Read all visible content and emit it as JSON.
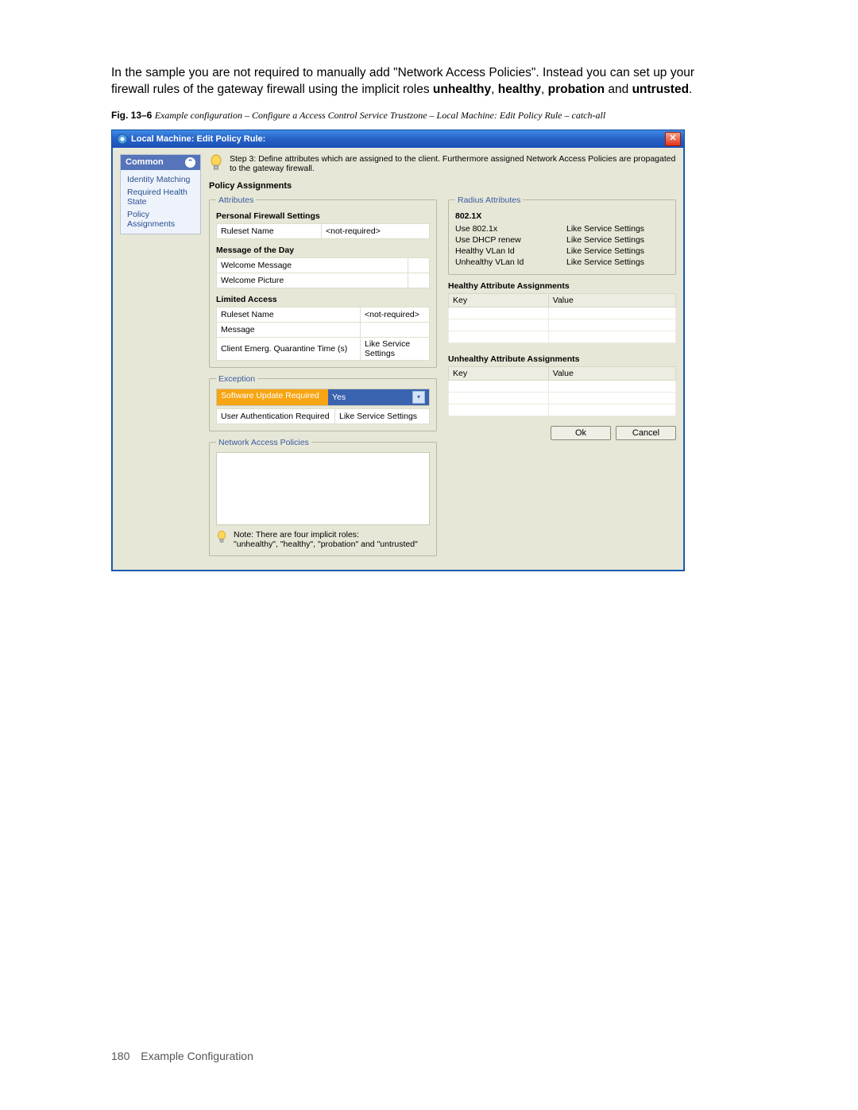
{
  "intro_html": "In the sample you are not required to manually add \"Network Access Policies\". Instead you can set up your firewall rules of the gateway firewall using the implicit roles <b>unhealthy</b>, <b>healthy</b>, <b>probation</b> and <b>untrusted</b>.",
  "figcap_prefix": "Fig. 13–6 ",
  "figcap_italic": "Example configuration – Configure a Access Control Service Trustzone – Local Machine: Edit Policy Rule – catch-all",
  "dialog": {
    "title": "Local Machine: Edit Policy Rule:",
    "sidebar": {
      "header": "Common",
      "items": [
        "Identity Matching",
        "Required Health State",
        "Policy Assignments"
      ]
    },
    "step_text": "Step 3: Define attributes which are assigned to the client. Furthermore assigned Network Access Policies are propagated to the gateway firewall.",
    "section_title": "Policy Assignments",
    "attributes_legend": "Attributes",
    "pfs_title": "Personal Firewall Settings",
    "pfs_rows": [
      {
        "k": "Ruleset Name",
        "v": "<not-required>"
      }
    ],
    "motd_title": "Message of the Day",
    "motd_rows": [
      {
        "k": "Welcome Message",
        "v": ""
      },
      {
        "k": "Welcome Picture",
        "v": ""
      }
    ],
    "la_title": "Limited Access",
    "la_rows": [
      {
        "k": "Ruleset Name",
        "v": "<not-required>"
      },
      {
        "k": "Message",
        "v": ""
      },
      {
        "k": "Client Emerg. Quarantine Time (s)",
        "v": "Like Service Settings"
      }
    ],
    "exception_legend": "Exception",
    "exc_highlight": {
      "k": "Software Update Required",
      "v": "Yes"
    },
    "exc_rows": [
      {
        "k": "User Authentication Required",
        "v": "Like Service Settings"
      }
    ],
    "nap_legend": "Network Access Policies",
    "note_line1": "Note: There are four implicit roles:",
    "note_line2": "\"unhealthy\", \"healthy\", \"probation\" and \"untrusted\"",
    "radius_legend": "Radius Attributes",
    "r8021x_title": "802.1X",
    "r8021x_rows": [
      {
        "k": "Use 802.1x",
        "v": "Like Service Settings"
      },
      {
        "k": "Use DHCP renew",
        "v": "Like Service Settings"
      },
      {
        "k": "Healthy VLan Id",
        "v": "Like Service Settings"
      },
      {
        "k": "Unhealthy VLan Id",
        "v": "Like Service Settings"
      }
    ],
    "healthy_title": "Healthy Attribute Assignments",
    "unhealthy_title": "Unhealthy Attribute Assignments",
    "kv_headers": {
      "key": "Key",
      "value": "Value"
    },
    "buttons": {
      "ok": "Ok",
      "cancel": "Cancel"
    }
  },
  "footer": {
    "page": "180",
    "label": "Example Configuration"
  }
}
